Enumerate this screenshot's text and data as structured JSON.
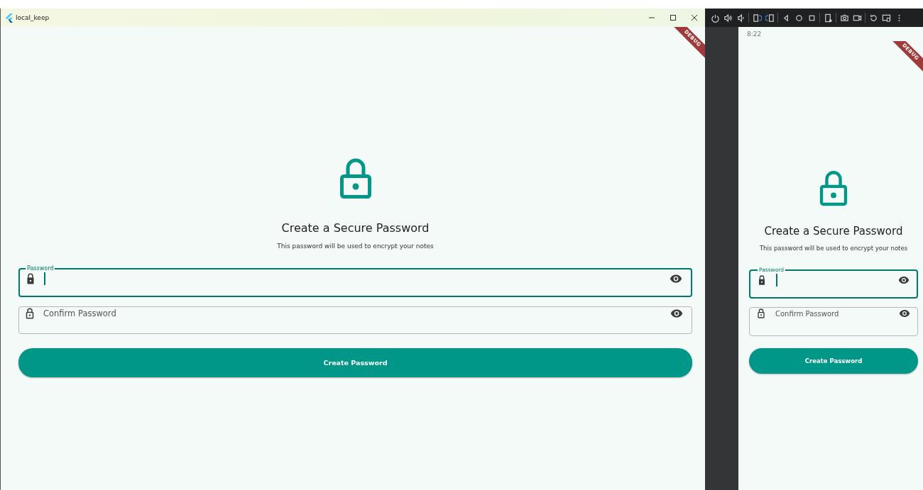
{
  "desktop_window": {
    "title": "local_keep",
    "debug_banner": "DEBUG",
    "screen": {
      "heading": "Create a Secure Password",
      "subtitle": "This password will be used to encrypt your notes",
      "fields": [
        {
          "label": "Password",
          "focused": true
        },
        {
          "label": "Confirm Password",
          "focused": false
        }
      ],
      "button": "Create Password"
    }
  },
  "emulator": {
    "status_time": "8:22",
    "debug_banner": "DEBUG",
    "screen": {
      "heading": "Create a Secure Password",
      "subtitle": "This password will be used to encrypt your notes",
      "fields": [
        {
          "label": "Password",
          "focused": true
        },
        {
          "label": "Confirm Password",
          "focused": false
        }
      ],
      "button": "Create Password"
    }
  }
}
